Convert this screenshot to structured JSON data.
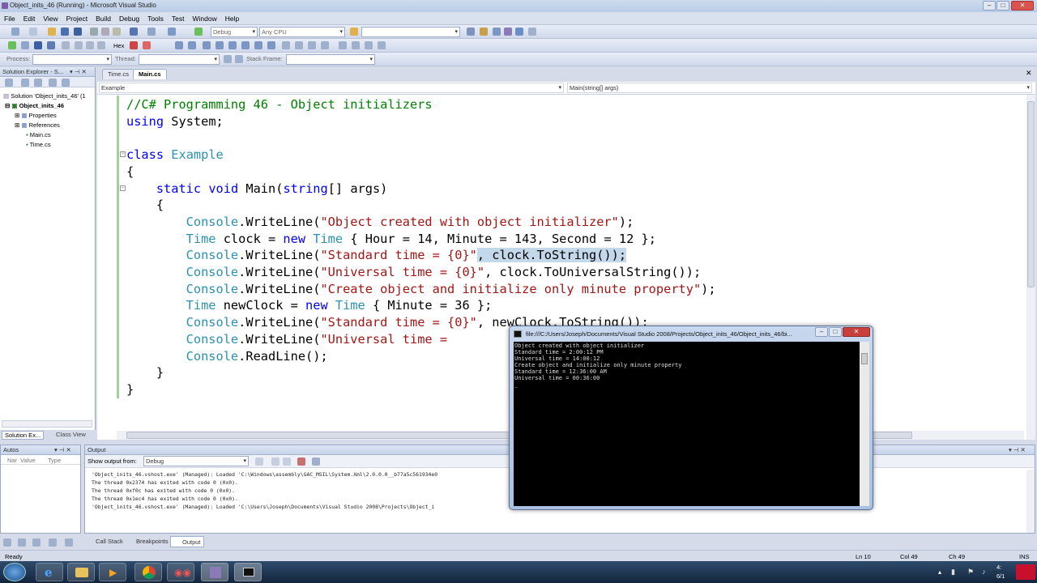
{
  "window_title": "Object_inits_46 (Running) - Microsoft Visual Studio",
  "menu": [
    "File",
    "Edit",
    "View",
    "Project",
    "Build",
    "Debug",
    "Tools",
    "Test",
    "Window",
    "Help"
  ],
  "toolbar": {
    "config": "Debug",
    "platform": "Any CPU",
    "hex_label": "Hex"
  },
  "debug_location": {
    "process_label": "Process:",
    "thread_label": "Thread:",
    "stack_label": "Stack Frame:"
  },
  "solution_explorer": {
    "title": "Solution Explorer - S...",
    "items": [
      "Solution 'Object_inits_46' (1",
      "Object_inits_46",
      "Properties",
      "References",
      "Main.cs",
      "Time.cs"
    ],
    "tabs": [
      "Solution Ex...",
      "Class View"
    ]
  },
  "editor": {
    "tabs": [
      "Time.cs",
      "Main.cs"
    ],
    "nav_left": "Example",
    "nav_right": "Main(string[] args)",
    "lines": [
      [
        [
          "cm",
          "//C# Programming 46 - Object initializers"
        ]
      ],
      [
        [
          "kw",
          "using"
        ],
        [
          "",
          "System;"
        ]
      ],
      [
        [
          "",
          ""
        ]
      ],
      [
        [
          "kw",
          "class"
        ],
        [
          "",
          ""
        ],
        [
          "ty",
          "Example"
        ]
      ],
      [
        [
          "",
          "{"
        ]
      ],
      [
        [
          "kw",
          "    static"
        ],
        [
          "kw",
          " void"
        ],
        [
          "",
          " Main("
        ],
        [
          "kw",
          "string"
        ],
        [
          "",
          "[] args)"
        ]
      ],
      [
        [
          "",
          "    {"
        ]
      ],
      [
        [
          "ty",
          "        Console"
        ],
        [
          "",
          ".WriteLine("
        ],
        [
          "st",
          "\"Object created with object initializer\""
        ],
        [
          "",
          ");"
        ]
      ],
      [
        [
          "ty",
          "        Time"
        ],
        [
          "",
          " clock = "
        ],
        [
          "kw",
          "new"
        ],
        [
          "ty",
          " Time"
        ],
        [
          "",
          " { Hour = 14, Minute = 143, Second = 12 };"
        ]
      ],
      [
        [
          "ty",
          "        Console"
        ],
        [
          "",
          ".WriteLine("
        ],
        [
          "st",
          "\"Standard time = {0}\""
        ],
        [
          "sel",
          ", clock.ToString());"
        ]
      ],
      [
        [
          "ty",
          "        Console"
        ],
        [
          "",
          ".WriteLine("
        ],
        [
          "st",
          "\"Universal time = {0}\""
        ],
        [
          "",
          ", clock.ToUniversalString());"
        ]
      ],
      [
        [
          "ty",
          "        Console"
        ],
        [
          "",
          ".WriteLine("
        ],
        [
          "st",
          "\"Create object and initialize only minute property\""
        ],
        [
          "",
          ");"
        ]
      ],
      [
        [
          "ty",
          "        Time"
        ],
        [
          "",
          " newClock = "
        ],
        [
          "kw",
          "new"
        ],
        [
          "ty",
          " Time"
        ],
        [
          "",
          " { Minute = 36 };"
        ]
      ],
      [
        [
          "ty",
          "        Console"
        ],
        [
          "",
          ".WriteLine("
        ],
        [
          "st",
          "\"Standard time = {0}\""
        ],
        [
          "",
          ", newClock.ToString());"
        ]
      ],
      [
        [
          "ty",
          "        Console"
        ],
        [
          "",
          ".WriteLine("
        ],
        [
          "st",
          "\"Universal time = "
        ]
      ],
      [
        [
          "ty",
          "        Console"
        ],
        [
          "",
          ".ReadLine();"
        ]
      ],
      [
        [
          "",
          "    }"
        ]
      ],
      [
        [
          "",
          "}"
        ]
      ]
    ]
  },
  "autos": {
    "title": "Autos",
    "col_name": "Nar",
    "col_value": "Value",
    "col_type": "Type"
  },
  "output": {
    "title": "Output",
    "show_from_label": "Show output from:",
    "show_from_value": "Debug",
    "lines": [
      "'Object_inits_46.vshost.exe' (Managed): Loaded 'C:\\Windows\\assembly\\GAC_MSIL\\System.Xml\\2.0.0.0__b77a5c561934e0",
      "The thread 0x2374 has exited with code 0 (0x0).",
      "The thread 0xf0c has exited with code 0 (0x0).",
      "The thread 0x1ec4 has exited with code 0 (0x0).",
      "'Object_inits_46.vshost.exe' (Managed): Loaded 'C:\\Users\\Joseph\\Documents\\Visual Studio 2008\\Projects\\Object_i"
    ]
  },
  "bottom_tabs": [
    "Call Stack",
    "Breakpoints",
    "Output"
  ],
  "status": {
    "left": "Ready",
    "ln": "Ln 10",
    "col": "Col 49",
    "ch": "Ch 49",
    "ins": "INS"
  },
  "console": {
    "title": "file:///C:/Users/Joseph/Documents/Visual Studio 2008/Projects/Object_inits_46/Object_inits_46/bi...",
    "lines": [
      "Object created with object initializer",
      "Standard time = 2:00:12 PM",
      "Universal time = 14:00:12",
      "Create object and initialize only minute property",
      "Standard time = 12:36:00 AM",
      "Universal time = 00:36:00",
      "_"
    ]
  },
  "taskbar": {
    "clock_time": "4:",
    "clock_date": "6/1"
  }
}
